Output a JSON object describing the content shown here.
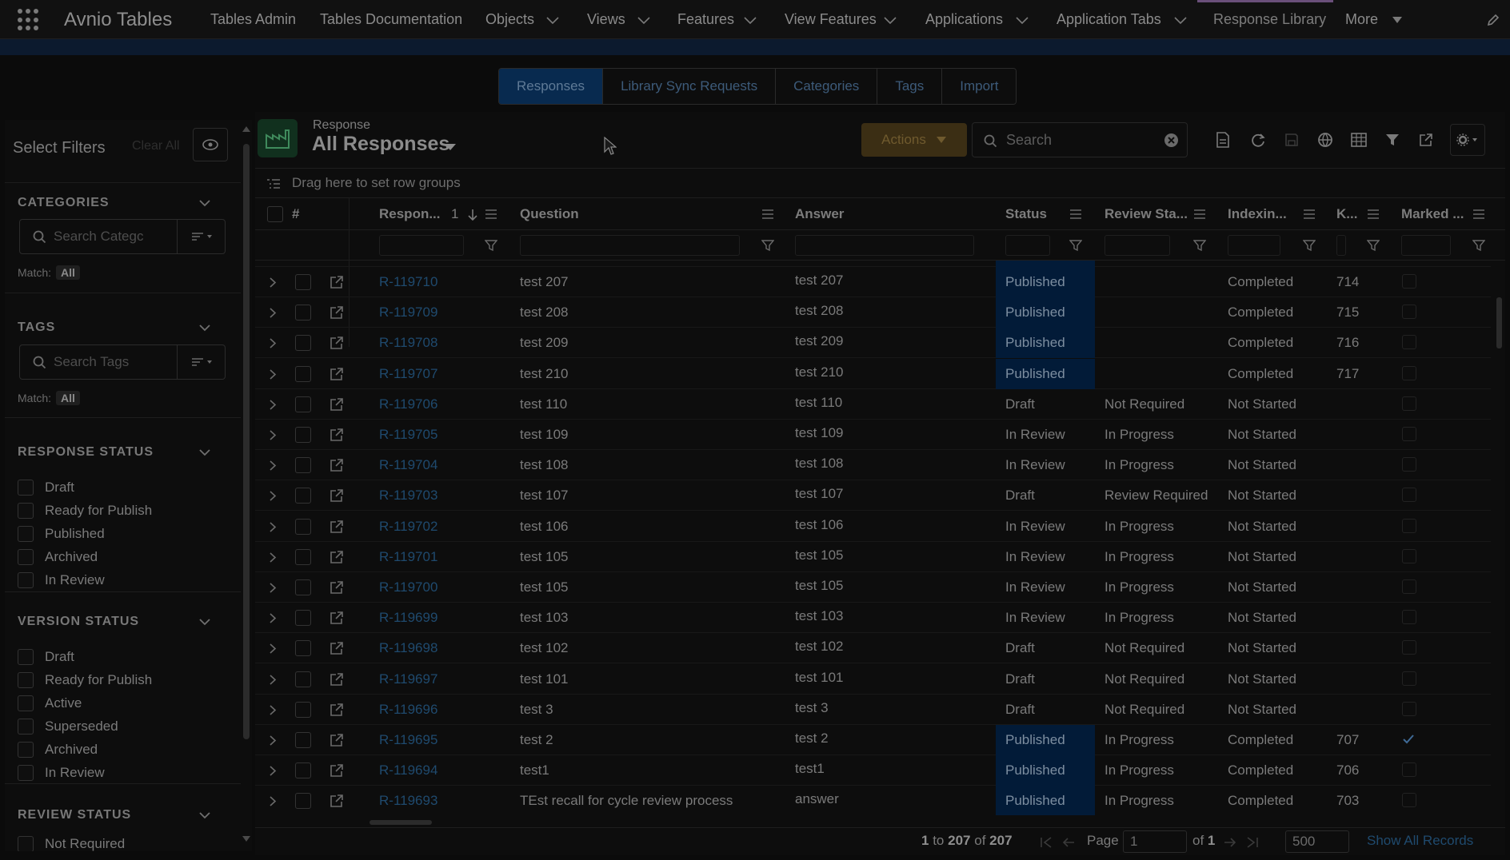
{
  "app": {
    "name": "Avnio Tables"
  },
  "nav": {
    "items": [
      {
        "label": "Tables Admin",
        "dropdown": false
      },
      {
        "label": "Tables Documentation",
        "dropdown": false
      },
      {
        "label": "Objects",
        "dropdown": true
      },
      {
        "label": "Views",
        "dropdown": true
      },
      {
        "label": "Features",
        "dropdown": true
      },
      {
        "label": "View Features",
        "dropdown": true
      },
      {
        "label": "Applications",
        "dropdown": true
      },
      {
        "label": "Application Tabs",
        "dropdown": true
      },
      {
        "label": "Response Library",
        "dropdown": false,
        "active": true
      },
      {
        "label": "More",
        "dropdown": true
      }
    ]
  },
  "tabs": {
    "items": [
      {
        "label": "Responses",
        "active": true
      },
      {
        "label": "Library Sync Requests"
      },
      {
        "label": "Categories"
      },
      {
        "label": "Tags"
      },
      {
        "label": "Import"
      }
    ]
  },
  "sidebar": {
    "title": "Select Filters",
    "clear_all": "Clear All",
    "categories": {
      "label": "CATEGORIES",
      "placeholder": "Search Categc",
      "match_label": "Match:",
      "match_value": "All"
    },
    "tags": {
      "label": "TAGS",
      "placeholder": "Search Tags",
      "match_label": "Match:",
      "match_value": "All"
    },
    "response_status": {
      "label": "RESPONSE STATUS",
      "options": [
        "Draft",
        "Ready for Publish",
        "Published",
        "Archived",
        "In Review"
      ]
    },
    "version_status": {
      "label": "VERSION STATUS",
      "options": [
        "Draft",
        "Ready for Publish",
        "Active",
        "Superseded",
        "Archived",
        "In Review"
      ]
    },
    "review_status": {
      "label": "REVIEW STATUS",
      "options": [
        "Not Required"
      ]
    }
  },
  "header": {
    "object_label": "Response",
    "view_title": "All Responses",
    "actions_label": "Actions",
    "search_placeholder": "Search",
    "row_group_hint": "Drag here to set row groups"
  },
  "table": {
    "columns": {
      "num": "#",
      "response": "Respon...",
      "sort_index": "1",
      "question": "Question",
      "answer": "Answer",
      "status": "Status",
      "review": "Review Sta...",
      "indexing": "Indexin...",
      "k": "K...",
      "marked": "Marked ..."
    },
    "rows": [
      {
        "id": "R-119710",
        "question": "test 207",
        "answer": "test 207",
        "status": "Published",
        "review": "",
        "indexing": "Completed",
        "k": "714",
        "marked": false
      },
      {
        "id": "R-119709",
        "question": "test 208",
        "answer": "test 208",
        "status": "Published",
        "review": "",
        "indexing": "Completed",
        "k": "715",
        "marked": false
      },
      {
        "id": "R-119708",
        "question": "test 209",
        "answer": "test 209",
        "status": "Published",
        "review": "",
        "indexing": "Completed",
        "k": "716",
        "marked": false
      },
      {
        "id": "R-119707",
        "question": "test 210",
        "answer": "test 210",
        "status": "Published",
        "review": "",
        "indexing": "Completed",
        "k": "717",
        "marked": false
      },
      {
        "id": "R-119706",
        "question": "test 110",
        "answer": "test 110",
        "status": "Draft",
        "review": "Not Required",
        "indexing": "Not Started",
        "k": "",
        "marked": false
      },
      {
        "id": "R-119705",
        "question": "test 109",
        "answer": "test 109",
        "status": "In Review",
        "review": "In Progress",
        "indexing": "Not Started",
        "k": "",
        "marked": false
      },
      {
        "id": "R-119704",
        "question": "test 108",
        "answer": "test 108",
        "status": "In Review",
        "review": "In Progress",
        "indexing": "Not Started",
        "k": "",
        "marked": false
      },
      {
        "id": "R-119703",
        "question": "test 107",
        "answer": "test 107",
        "status": "Draft",
        "review": "Review Required",
        "indexing": "Not Started",
        "k": "",
        "marked": false
      },
      {
        "id": "R-119702",
        "question": "test 106",
        "answer": "test 106",
        "status": "In Review",
        "review": "In Progress",
        "indexing": "Not Started",
        "k": "",
        "marked": false
      },
      {
        "id": "R-119701",
        "question": "test 105",
        "answer": "test 105",
        "status": "In Review",
        "review": "In Progress",
        "indexing": "Not Started",
        "k": "",
        "marked": false
      },
      {
        "id": "R-119700",
        "question": "test 105",
        "answer": "test 105",
        "status": "In Review",
        "review": "In Progress",
        "indexing": "Not Started",
        "k": "",
        "marked": false
      },
      {
        "id": "R-119699",
        "question": "test 103",
        "answer": "test 103",
        "status": "In Review",
        "review": "In Progress",
        "indexing": "Not Started",
        "k": "",
        "marked": false
      },
      {
        "id": "R-119698",
        "question": "test 102",
        "answer": "test 102",
        "status": "Draft",
        "review": "Not Required",
        "indexing": "Not Started",
        "k": "",
        "marked": false
      },
      {
        "id": "R-119697",
        "question": "test 101",
        "answer": "test 101",
        "status": "Draft",
        "review": "Not Required",
        "indexing": "Not Started",
        "k": "",
        "marked": false
      },
      {
        "id": "R-119696",
        "question": "test 3",
        "answer": "test 3",
        "status": "Draft",
        "review": "Not Required",
        "indexing": "Not Started",
        "k": "",
        "marked": false
      },
      {
        "id": "R-119695",
        "question": "test 2",
        "answer": "test 2",
        "status": "Published",
        "review": "In Progress",
        "indexing": "Completed",
        "k": "707",
        "marked": true
      },
      {
        "id": "R-119694",
        "question": "test1",
        "answer": "test1",
        "status": "Published",
        "review": "In Progress",
        "indexing": "Completed",
        "k": "706",
        "marked": false
      },
      {
        "id": "R-119693",
        "question": "TEst recall for cycle review process",
        "answer": "answer",
        "status": "Published",
        "review": "In Progress",
        "indexing": "Completed",
        "k": "703",
        "marked": false
      }
    ]
  },
  "pagination": {
    "range_from": "1",
    "to_label": "to",
    "range_to": "207",
    "of_label": "of",
    "total": "207",
    "page_label": "Page",
    "page_value": "1",
    "of_pages_label": "of",
    "pages": "1",
    "page_size": "500",
    "show_all": "Show All Records"
  },
  "colors": {
    "published_bg": "#021b38",
    "link": "#1f4a6e",
    "actions_bg": "#3b2e14",
    "active_tab_bg": "#082a4f"
  }
}
